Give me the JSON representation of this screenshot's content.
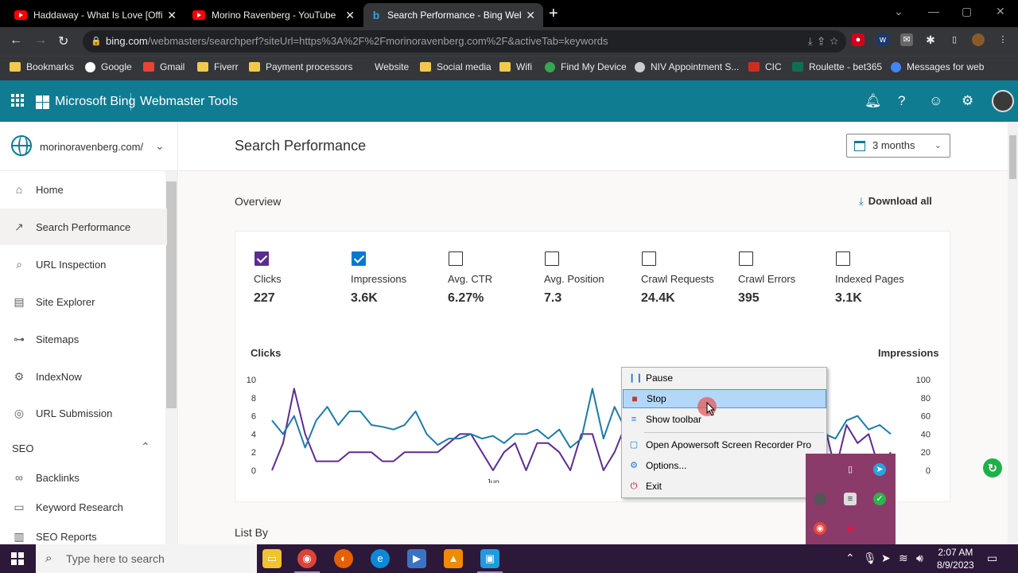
{
  "browser": {
    "tabs": [
      {
        "title": "Haddaway - What Is Love [Officia",
        "icon": "youtube-icon",
        "active": false
      },
      {
        "title": "Morino Ravenberg - YouTube",
        "icon": "youtube-icon",
        "active": false
      },
      {
        "title": "Search Performance - Bing Webm",
        "icon": "bing-icon",
        "active": true
      }
    ],
    "url_domain": "bing.com",
    "url_path": "/webmasters/searchperf?siteUrl=https%3A%2F%2Fmorinoravenberg.com%2F&activeTab=keywords",
    "bookmarks": [
      "Bookmarks",
      "Google",
      "Gmail",
      "Fiverr",
      "Payment processors",
      "Website",
      "Social media",
      "Wifi",
      "Find My Device",
      "NIV Appointment S...",
      "CIC",
      "Roulette - bet365",
      "Messages for web"
    ]
  },
  "header": {
    "brand": "Microsoft Bing",
    "product": "Webmaster Tools",
    "color": "#0f7c91"
  },
  "sidebar": {
    "site": "morinoravenberg.com/",
    "items": [
      {
        "label": "Home",
        "icon": "home-icon"
      },
      {
        "label": "Search Performance",
        "icon": "trend-icon",
        "selected": true
      },
      {
        "label": "URL Inspection",
        "icon": "search-icon"
      },
      {
        "label": "Site Explorer",
        "icon": "document-icon"
      },
      {
        "label": "Sitemaps",
        "icon": "sitemap-icon"
      },
      {
        "label": "IndexNow",
        "icon": "gear-icon"
      },
      {
        "label": "URL Submission",
        "icon": "globe-icon"
      }
    ],
    "seo_section": "SEO",
    "seo_items": [
      {
        "label": "Backlinks",
        "icon": "link-icon"
      },
      {
        "label": "Keyword Research",
        "icon": "keyword-icon"
      },
      {
        "label": "SEO Reports",
        "icon": "report-icon"
      }
    ]
  },
  "main": {
    "title": "Search Performance",
    "date_range": "3 months",
    "overview": "Overview",
    "download": "Download all",
    "list_by": "List By",
    "metrics": [
      {
        "label": "Clicks",
        "value": "227",
        "checked": true,
        "color": "#5c2d91"
      },
      {
        "label": "Impressions",
        "value": "3.6K",
        "checked": true,
        "color": "#0078d4"
      },
      {
        "label": "Avg. CTR",
        "value": "6.27%",
        "checked": false
      },
      {
        "label": "Avg. Position",
        "value": "7.3",
        "checked": false
      },
      {
        "label": "Crawl Requests",
        "value": "24.4K",
        "checked": false
      },
      {
        "label": "Crawl Errors",
        "value": "395",
        "checked": false
      },
      {
        "label": "Indexed Pages",
        "value": "3.1K",
        "checked": false
      }
    ]
  },
  "chart_data": {
    "type": "line",
    "left_axis_label": "Clicks",
    "right_axis_label": "Impressions",
    "left_ticks": [
      "10",
      "8",
      "6",
      "4",
      "2",
      "0"
    ],
    "right_ticks": [
      "100",
      "80",
      "60",
      "40",
      "20",
      "0"
    ],
    "ylim_left": [
      0,
      10
    ],
    "ylim_right": [
      0,
      100
    ],
    "x_tick_label": "Jun",
    "x_tick_index": 20,
    "series": [
      {
        "name": "Clicks",
        "color": "#5c2d91",
        "axis": "left",
        "values": [
          0,
          3,
          9,
          4,
          1,
          1,
          1,
          2,
          2,
          2,
          1,
          1,
          2,
          2,
          2,
          2,
          3,
          4,
          4,
          2,
          0,
          2,
          3,
          0,
          3,
          3,
          2,
          0,
          4,
          4,
          0,
          2,
          5,
          3,
          1,
          0,
          1,
          2,
          1,
          3,
          6,
          2,
          3,
          2,
          4,
          0,
          3,
          4,
          2,
          3,
          5,
          0,
          5,
          3,
          4,
          0,
          2
        ]
      },
      {
        "name": "Impressions",
        "color": "#1f7aa8",
        "axis": "right",
        "values": [
          55,
          40,
          60,
          25,
          55,
          70,
          50,
          65,
          65,
          50,
          48,
          45,
          50,
          65,
          40,
          28,
          35,
          35,
          40,
          35,
          38,
          30,
          40,
          40,
          45,
          35,
          45,
          25,
          35,
          90,
          35,
          70,
          45,
          35,
          45,
          15,
          35,
          20,
          40,
          30,
          45,
          45,
          35,
          40,
          40,
          20,
          45,
          35,
          15,
          40,
          40,
          35,
          55,
          60,
          45,
          50,
          40
        ]
      }
    ]
  },
  "context_menu": {
    "items": [
      {
        "label": "Pause",
        "icon": "pause-icon"
      },
      {
        "label": "Stop",
        "icon": "stop-icon",
        "highlighted": true
      },
      {
        "label": "Show toolbar",
        "icon": "toolbar-icon"
      },
      {
        "label": "Open Apowersoft Screen Recorder Pro",
        "icon": "recorder-icon"
      },
      {
        "label": "Options...",
        "icon": "gear-icon"
      },
      {
        "label": "Exit",
        "icon": "power-icon"
      }
    ]
  },
  "taskbar": {
    "search_placeholder": "Type here to search",
    "time": "2:07 AM",
    "date": "8/9/2023"
  }
}
